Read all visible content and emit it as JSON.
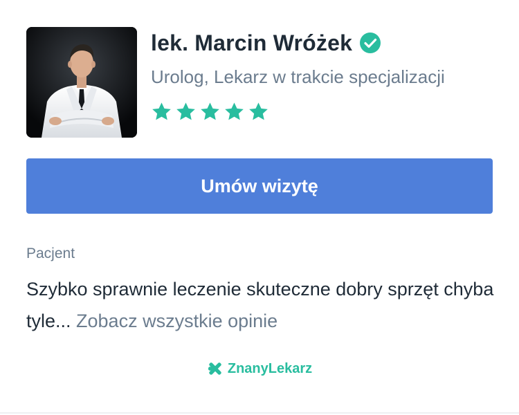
{
  "doctor": {
    "name": "lek. Marcin Wróżek",
    "verified_icon": "check-circle-icon",
    "specialty": "Urolog, Lekarz w trakcie specjalizacji",
    "rating": 5,
    "rating_max": 5,
    "photo": "doctor-portrait"
  },
  "actions": {
    "book_label": "Umów wizytę"
  },
  "review": {
    "author": "Pacjent",
    "text": "Szybko sprawnie leczenie skuteczne dobry sprzęt chyba tyle...",
    "see_all": "Zobacz wszystkie opinie"
  },
  "brand": {
    "name": "ZnanyLekarz",
    "icon": "znanylekarz-logo-icon"
  },
  "colors": {
    "accent_green": "#29bd9f",
    "button_blue": "#4f7fda",
    "text_dark": "#1f2b37",
    "text_muted": "#6b7c8e"
  }
}
